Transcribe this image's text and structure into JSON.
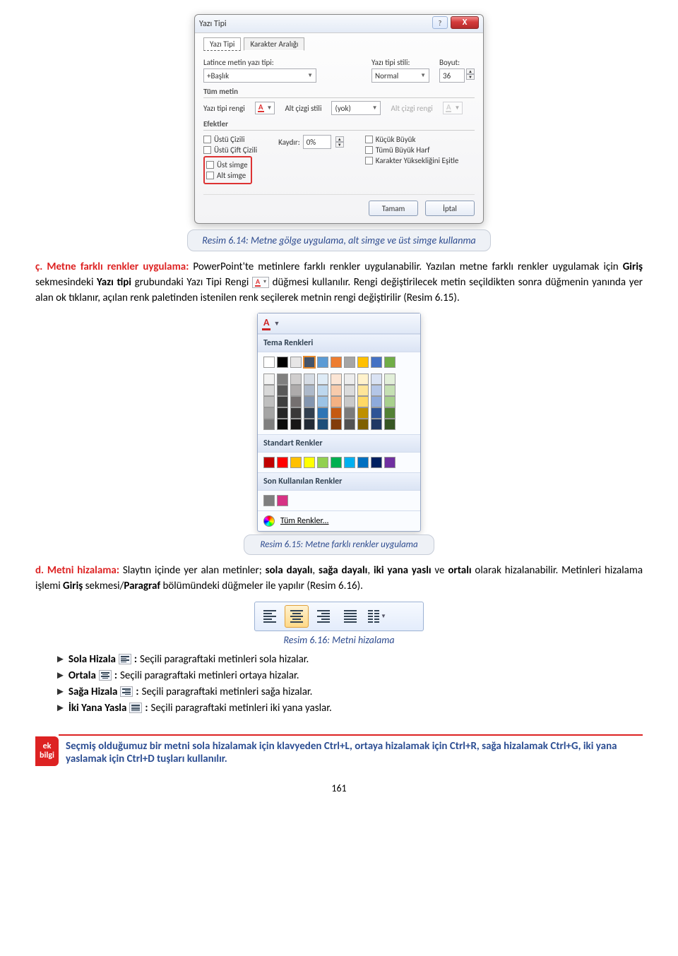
{
  "fontDialog": {
    "title": "Yazı Tipi",
    "tabs": {
      "font": "Yazı Tipi",
      "spacing": "Karakter Aralığı"
    },
    "labels": {
      "latin": "Latince metin yazı tipi:",
      "style": "Yazı tipi stili:",
      "size": "Boyut:",
      "allText": "Tüm metin",
      "fontColor": "Yazı tipi rengi",
      "underlineStyle": "Alt çizgi stili",
      "underlineColor": "Alt çizgi rengi",
      "effects": "Efektler",
      "offset": "Kaydır:"
    },
    "values": {
      "latin": "+Başlık",
      "style": "Normal",
      "size": "36",
      "underlineStyle": "(yok)",
      "offset": "0%"
    },
    "effects": {
      "strike": "Üstü Çizili",
      "dstrike": "Üstü Çift Çizili",
      "superscript": "Üst simge",
      "subscript": "Alt simge",
      "smallCaps": "Küçük Büyük",
      "allCaps": "Tümü Büyük Harf",
      "equalize": "Karakter Yüksekliğini Eşitle"
    },
    "buttons": {
      "ok": "Tamam",
      "cancel": "İptal",
      "help": "?",
      "close": "X"
    }
  },
  "caption614": "Resim 6.14: Metne gölge uygulama, alt simge ve üst simge kullanma",
  "paraC": {
    "lead": "ç. Metne farklı renkler uygulama:",
    "t1": " PowerPoint'te metinlere farklı renkler uygulanabilir. Yazılan metne farklı renkler uygulamak için ",
    "b1": "Giriş",
    "t2": " sekmesindeki ",
    "b2": "Yazı tipi",
    "t3": " grubundaki Yazı Tipi Rengi ",
    "t4": " düğmesi kullanılır. Rengi değiştirilecek metin seçildikten sonra düğmenin yanında yer alan ok tıklanır, açılan renk paletinden istenilen renk seçilerek metnin rengi değiştirilir (Resim 6.15)."
  },
  "palette": {
    "theme": "Tema Renkleri",
    "standard": "Standart Renkler",
    "recent": "Son Kullanılan Renkler",
    "more": "Tüm Renkler...",
    "themeRow1": [
      "#ffffff",
      "#000000",
      "#e7e6e6",
      "#44546a",
      "#5b9bd5",
      "#ed7d31",
      "#a5a5a5",
      "#ffc000",
      "#4472c4",
      "#70ad47"
    ],
    "themeShades": [
      [
        "#f2f2f2",
        "#7f7f7f",
        "#d0cece",
        "#d6dce4",
        "#deebf6",
        "#fbe5d5",
        "#ededed",
        "#fff2cc",
        "#d9e2f3",
        "#e2efd9"
      ],
      [
        "#d8d8d8",
        "#595959",
        "#aeabab",
        "#adb9ca",
        "#bdd7ee",
        "#f7cbac",
        "#dbdbdb",
        "#fee599",
        "#b4c6e7",
        "#c5e0b3"
      ],
      [
        "#bfbfbf",
        "#3f3f3f",
        "#757070",
        "#8496b0",
        "#9cc3e5",
        "#f4b183",
        "#c9c9c9",
        "#ffd965",
        "#8eaadb",
        "#a8d08d"
      ],
      [
        "#a5a5a5",
        "#262626",
        "#3a3838",
        "#323f4f",
        "#2e75b5",
        "#c55a11",
        "#7b7b7b",
        "#bf9000",
        "#2f5496",
        "#538135"
      ],
      [
        "#7f7f7f",
        "#0c0c0c",
        "#171616",
        "#222a35",
        "#1e4e79",
        "#833c0b",
        "#525252",
        "#7f6000",
        "#1f3864",
        "#375623"
      ]
    ],
    "standardRow": [
      "#c00000",
      "#ff0000",
      "#ffc000",
      "#ffff00",
      "#92d050",
      "#00b050",
      "#00b0f0",
      "#0070c0",
      "#002060",
      "#7030a0"
    ],
    "recentRow": [
      "#7f7f7f",
      "#d63384"
    ]
  },
  "caption615": "Resim 6.15: Metne farklı renkler uygulama",
  "paraD": {
    "lead": "d. Metni hizalama:",
    "t1": " Slaytın içinde yer alan metinler; ",
    "b1": "sola dayalı",
    "t2": ", ",
    "b2": "sağa dayalı",
    "t3": ", ",
    "b3": "iki yana yaslı",
    "t4": " ve ",
    "b4": "ortalı",
    "t5": " olarak hizalanabilir. Metinleri hizalama işlemi ",
    "b5": "Giriş",
    "t6": " sekmesi/",
    "b6": "Paragraf",
    "t7": " bölümündeki düğmeler ile yapılır (Resim 6.16)."
  },
  "caption616": "Resim 6.16: Metni hizalama",
  "alignList": {
    "left": {
      "name": "Sola Hizala",
      "desc": "Seçili paragraftaki metinleri sola hizalar."
    },
    "center": {
      "name": "Ortala",
      "desc": "Seçili paragraftaki metinleri ortaya hizalar."
    },
    "right": {
      "name": "Sağa Hizala",
      "desc": "Seçili paragraftaki metinleri sağa hizalar."
    },
    "just": {
      "name": "İki Yana Yasla",
      "desc": "Seçili paragraftaki metinleri iki yana yaslar."
    }
  },
  "ekBilgi": {
    "tag": "ek\nbilgi",
    "text": "Seçmiş olduğumuz bir metni sola hizalamak için klavyeden Ctrl+L, ortaya hizalamak için Ctrl+R, sağa hizalamak Ctrl+G, iki yana yaslamak için Ctrl+D tuşları kullanılır."
  },
  "pageNumber": "161"
}
